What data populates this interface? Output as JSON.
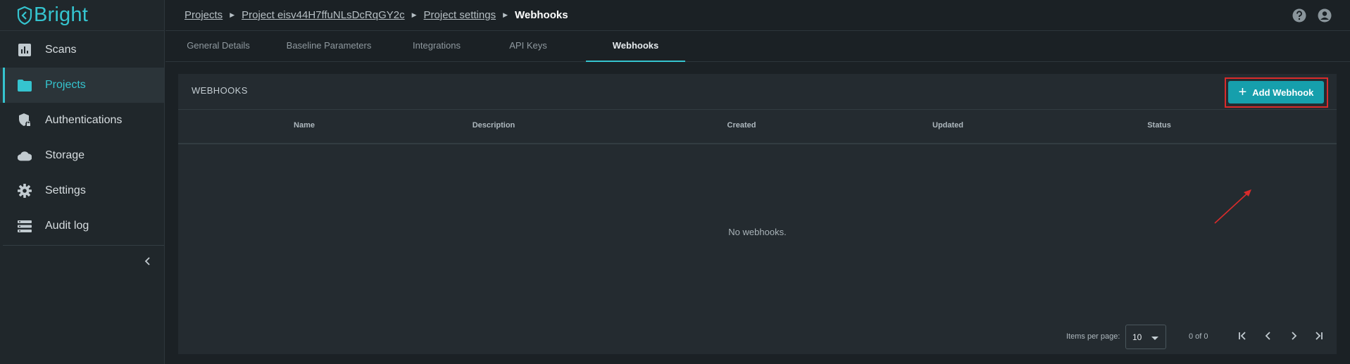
{
  "app": {
    "logo_text": "Bright",
    "accent": "#35c4cf"
  },
  "sidebar": {
    "items": [
      {
        "label": "Scans",
        "icon": "bar-chart-icon",
        "active": false
      },
      {
        "label": "Projects",
        "icon": "folder-icon",
        "active": true
      },
      {
        "label": "Authentications",
        "icon": "shield-lock-icon",
        "active": false
      },
      {
        "label": "Storage",
        "icon": "cloud-icon",
        "active": false
      },
      {
        "label": "Settings",
        "icon": "gear-icon",
        "active": false
      },
      {
        "label": "Audit log",
        "icon": "list-icon",
        "active": false
      }
    ],
    "collapse_icon": "chevron-left-icon"
  },
  "breadcrumb": {
    "items": [
      "Projects",
      "Project eisv44H7ffuNLsDcRqGY2c",
      "Project settings"
    ],
    "current": "Webhooks"
  },
  "header_icons": [
    "help-icon",
    "account-icon"
  ],
  "tabs": [
    {
      "label": "General Details",
      "active": false
    },
    {
      "label": "Baseline Parameters",
      "active": false
    },
    {
      "label": "Integrations",
      "active": false
    },
    {
      "label": "API Keys",
      "active": false
    },
    {
      "label": "Webhooks",
      "active": true
    }
  ],
  "webhooks": {
    "title": "WEBHOOKS",
    "add_button": "Add Webhook",
    "columns": [
      "Name",
      "Description",
      "Created",
      "Updated",
      "Status"
    ],
    "empty_message": "No webhooks.",
    "pagination": {
      "items_per_page_label": "Items per page:",
      "items_per_page_value": "10",
      "range": "0 of 0"
    }
  },
  "annotation": {
    "highlight_color": "#d92b2b"
  }
}
